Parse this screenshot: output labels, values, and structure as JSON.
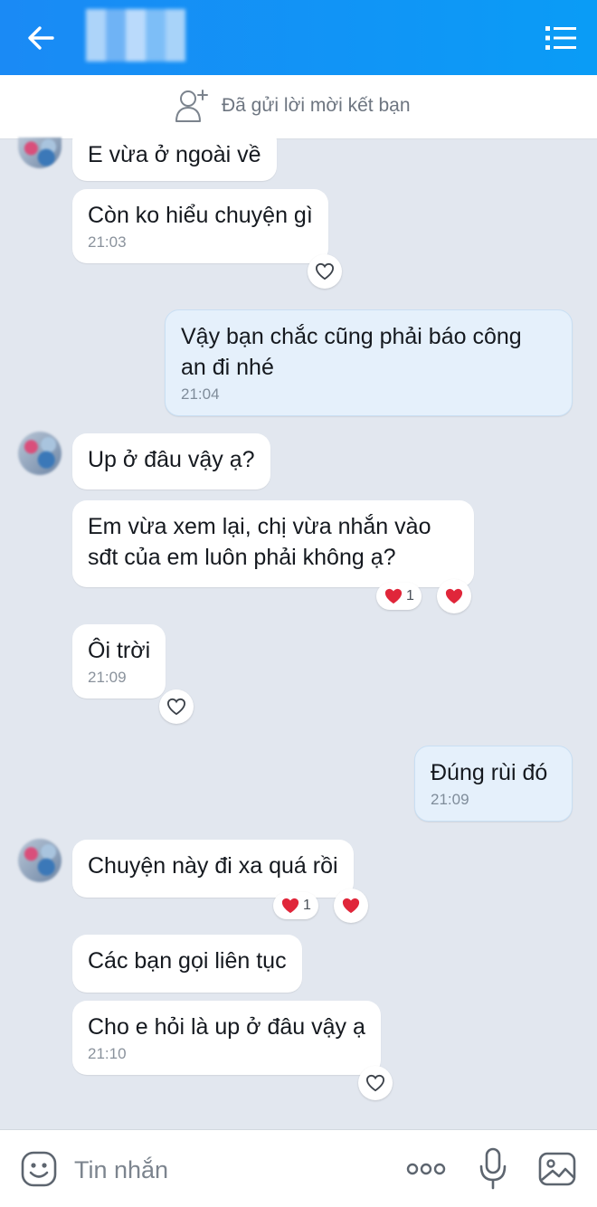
{
  "header": {
    "back_icon": "arrow-left-icon",
    "menu_icon": "list-menu-icon"
  },
  "friend_request": {
    "icon": "add-friend-icon",
    "text": "Đã gửi lời mời kết bạn"
  },
  "messages": [
    {
      "sender": "contact",
      "text": "E vừa ở ngoài về"
    },
    {
      "sender": "contact",
      "text": "Còn ko hiểu chuyện gì",
      "time": "21:03"
    },
    {
      "sender": "me",
      "line1": "Vậy bạn chắc cũng phải báo công",
      "line2": "an đi nhé",
      "time": "21:04"
    },
    {
      "sender": "contact",
      "text": "Up ở đâu vậy ạ?"
    },
    {
      "sender": "contact",
      "line1": "Em vừa xem lại, chị vừa nhắn vào",
      "line2": "sđt của em luôn phải không ạ?",
      "reaction_count": "1"
    },
    {
      "sender": "contact",
      "text": "Ôi trời",
      "time": "21:09"
    },
    {
      "sender": "me",
      "text": "Đúng rùi đó",
      "time": "21:09"
    },
    {
      "sender": "contact",
      "text": "Chuyện này đi xa quá rồi",
      "reaction_count": "1"
    },
    {
      "sender": "contact",
      "text": "Các bạn gọi liên tục"
    },
    {
      "sender": "contact",
      "text": "Cho e hỏi là up ở đâu vậy ạ",
      "time": "21:10"
    }
  ],
  "composer": {
    "placeholder": "Tin nhắn",
    "emoji_icon": "emoji-icon",
    "more_icon": "more-dots-icon",
    "mic_icon": "microphone-icon",
    "image_icon": "image-icon"
  },
  "colors": {
    "header": "#1a8af5",
    "background": "#e2e7ef",
    "sent_bubble": "#e5f0fb",
    "heart": "#e0263a"
  }
}
